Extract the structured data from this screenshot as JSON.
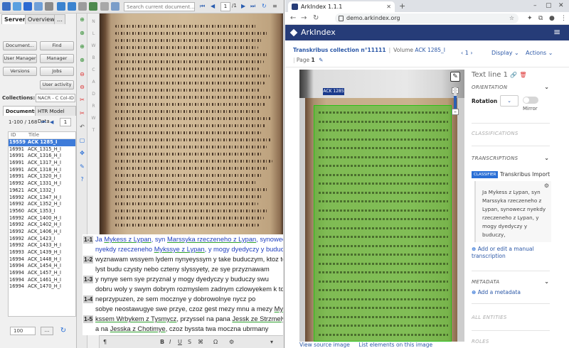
{
  "transkribus": {
    "search_placeholder": "Search current document...",
    "page_current": "1",
    "page_total": "/1",
    "tabs": {
      "server": "Server",
      "overview": "Overview",
      "more": "…"
    },
    "buttons": {
      "document": "Document...",
      "find": "Find",
      "user_manager": "User Manager",
      "collection_manager": "Manager",
      "versions": "Versions",
      "jobs": "Jobs",
      "user_activity": "User activity"
    },
    "collections": {
      "label": "Collections:",
      "value": "NACR - C  Col-ID"
    },
    "doc_tabs": {
      "documents": "Documents",
      "htr": "HTR Model Data"
    },
    "doc_range": "1-100 / 168",
    "doc_page": "1",
    "doc_columns": {
      "id": "ID",
      "title": "Title"
    },
    "documents": [
      {
        "id": "19559",
        "title": "ACK 1285_I"
      },
      {
        "id": "16991",
        "title": "ACK_1315_H_I"
      },
      {
        "id": "16991",
        "title": "ACK_1316_H_I"
      },
      {
        "id": "16991",
        "title": "ACK_1317_H_I"
      },
      {
        "id": "16991",
        "title": "ACK_1318_H_I"
      },
      {
        "id": "16991",
        "title": "ACK_1320_H_I"
      },
      {
        "id": "16992",
        "title": "ACK_1331_H_I"
      },
      {
        "id": "19621",
        "title": "ACK_1332_I"
      },
      {
        "id": "16992",
        "title": "ACK_1347_H_I"
      },
      {
        "id": "16992",
        "title": "ACK_1352_H_I"
      },
      {
        "id": "19560",
        "title": "ACK_1353_I"
      },
      {
        "id": "16992",
        "title": "ACK_1400_H_I"
      },
      {
        "id": "16992",
        "title": "ACK_1402_H_I"
      },
      {
        "id": "16992",
        "title": "ACK_1406_H_I"
      },
      {
        "id": "16992",
        "title": "ACK_1423_I"
      },
      {
        "id": "16992",
        "title": "ACK_1433_H_I"
      },
      {
        "id": "16993",
        "title": "ACK_1439_H_I"
      },
      {
        "id": "16994",
        "title": "ACK_1448_H_I"
      },
      {
        "id": "16994",
        "title": "ACK_1454_H_I"
      },
      {
        "id": "16994",
        "title": "ACK_1457_H_I"
      },
      {
        "id": "16994",
        "title": "ACK_1461_H_I"
      },
      {
        "id": "16994",
        "title": "ACK_1470_H_I"
      }
    ],
    "page_size": "100",
    "more_button": "...",
    "section_marks": [
      "N",
      "L",
      "W",
      "B",
      "C",
      "A",
      "D",
      "R",
      "W",
      "T"
    ],
    "text_lines": [
      {
        "num": "1-1",
        "parts": [
          {
            "t": "Ja ",
            "tag": false
          },
          {
            "t": "Mykess z Lypan",
            "tag": true
          },
          {
            "t": ", syn ",
            "tag": false
          },
          {
            "t": "Marssyka rzeczeneho z Lypan",
            "tag": true
          },
          {
            "t": ", synowecz",
            "tag": false
          }
        ]
      },
      {
        "num": "",
        "parts": [
          {
            "t": "nyekdy rzeczeneho ",
            "tag": false
          },
          {
            "t": "Mykssye z Lypan",
            "tag": true
          },
          {
            "t": ", y mogy dyedyczy y buduczy,",
            "tag": false
          }
        ]
      },
      {
        "num": "1-2",
        "parts": [
          {
            "t": "wyznawam wssyem lydem nynyeyssym y take buduczym, ktoz tento",
            "tag": false
          }
        ]
      },
      {
        "num": "",
        "parts": [
          {
            "t": "lyst budu czysty nebo czteny slyssyety, ze sye przyznawam",
            "tag": false
          }
        ]
      },
      {
        "num": "1-3",
        "parts": [
          {
            "t": "y nynye sem sye przyznal y mogy dyedyczy y buduczy swu",
            "tag": false
          }
        ]
      },
      {
        "num": "",
        "parts": [
          {
            "t": "dobru woly y swym dobrym rozmyslem zadnym czlowyekem k tomu",
            "tag": false
          }
        ]
      },
      {
        "num": "1-4",
        "parts": [
          {
            "t": "neprzypuzen, ze sem mocznye y dobrowolnye nycz po",
            "tag": false
          }
        ]
      },
      {
        "num": "",
        "parts": [
          {
            "t": "sobye neostawugye swe przye, czoz gest mezy mnu a mezy ",
            "tag": false
          },
          {
            "t": "My",
            "tag": true
          }
        ]
      },
      {
        "num": "1-5",
        "parts": [
          {
            "t": "kssem Wrbykem z Tysmycz",
            "tag": true
          },
          {
            "t": ", przyssel na pana ",
            "tag": false
          },
          {
            "t": "Jessk ze Strzmelycz",
            "tag": true
          }
        ]
      },
      {
        "num": "",
        "parts": [
          {
            "t": "a na ",
            "tag": false
          },
          {
            "t": "Jesska z Chotimye",
            "tag": true
          },
          {
            "t": ", czoz byssta twa moczna ubrmany",
            "tag": false
          }
        ]
      }
    ]
  },
  "browser": {
    "tab_title": "ArkIndex 1.1.1",
    "url": "demo.arkindex.org"
  },
  "arkindex": {
    "brand": "ArkIndex",
    "breadcrumb": {
      "collection": "Transkribus collection n°11111",
      "volume_prefix": "Volume ",
      "volume": "ACK 1285_I",
      "page_prefix": "Page ",
      "page": "1"
    },
    "pager": "1",
    "display": "Display",
    "actions": "Actions",
    "scan_label": "ACK 1285",
    "image_links": {
      "view": "View source image",
      "list": "List elements on this image"
    },
    "side": {
      "title": "Text line 1",
      "orientation": "ORIENTATION",
      "rotation_label": "Rotation",
      "mirror_label": "Mirror",
      "classifications": "CLASSIFICATIONS",
      "transcriptions": "TRANSCRIPTIONS",
      "classifier": "CLASSIFIER",
      "source": "Transkribus Import",
      "transcription_text": "Ja Mykess z Lypan, syn Marssyka rzeczeneho z Lypan, synowecz nyekdy rzeczeneho z Lypan, y mogy dyedyczy y buduczy,",
      "add_transcription": "Add or edit a manual transcription",
      "metadata": "METADATA",
      "add_metadata": "Add a metadata",
      "all_entities": "ALL ENTITIES",
      "roles": "ROLES"
    }
  }
}
